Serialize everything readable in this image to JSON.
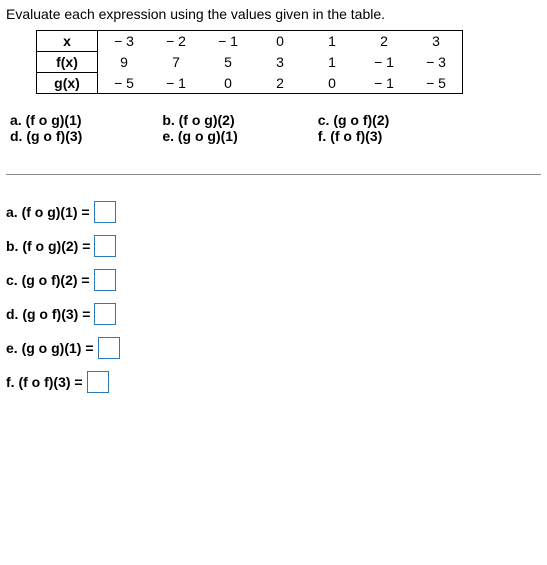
{
  "instruction": "Evaluate each expression using the values given in the table.",
  "table": {
    "head_x": "x",
    "head_f": "f(x)",
    "head_g": "g(x)",
    "x": [
      "− 3",
      "− 2",
      "− 1",
      "0",
      "1",
      "2",
      "3"
    ],
    "f": [
      "9",
      "7",
      "5",
      "3",
      "1",
      "− 1",
      "− 3"
    ],
    "g": [
      "− 5",
      "− 1",
      "0",
      "2",
      "0",
      "− 1",
      "− 5"
    ]
  },
  "problems": {
    "a": "a. (f o g)(1)",
    "b": "b. (f o g)(2)",
    "c": "c. (g o f)(2)",
    "d": "d. (g o f)(3)",
    "e": "e. (g o g)(1)",
    "f": "f. (f o f)(3)"
  },
  "answers": {
    "a_label": "a. (f o g)(1) =",
    "b_label": "b. (f o g)(2) =",
    "c_label": "c. (g o f)(2) =",
    "d_label": "d. (g o f)(3) =",
    "e_label": "e. (g o g)(1) =",
    "f_label": "f. (f o f)(3) ="
  }
}
